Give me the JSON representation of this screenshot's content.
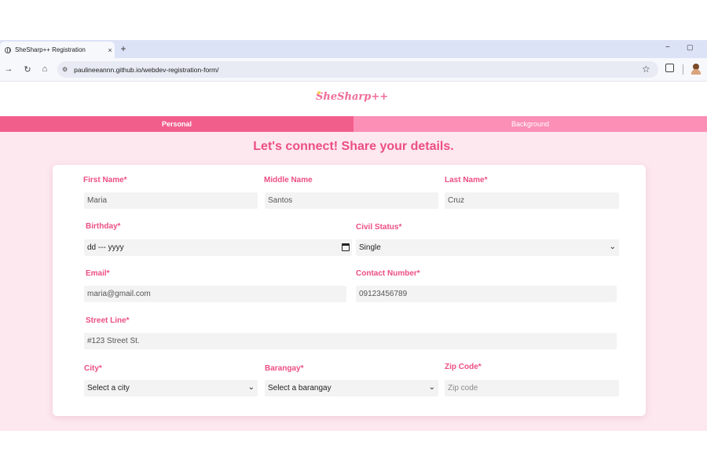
{
  "browser": {
    "tab_title": "SheSharp++ Registration",
    "tab_close": "×",
    "new_tab": "+",
    "url": "paulineeannn.github.io/webdev-registration-form/",
    "minimize": "−",
    "maximize": "▢"
  },
  "logo": {
    "text": "SheSharp++"
  },
  "steps": {
    "personal": "Personal",
    "background": "Background"
  },
  "heading": "Let's connect! Share your details.",
  "form": {
    "first_name": {
      "label": "First Name*",
      "value": "Maria"
    },
    "middle_name": {
      "label": "Middle Name",
      "value": "Santos"
    },
    "last_name": {
      "label": "Last Name*",
      "value": "Cruz"
    },
    "birthday": {
      "label": "Birthday*",
      "value": "dd --- yyyy"
    },
    "civil_status": {
      "label": "Civil Status*",
      "value": "Single"
    },
    "email": {
      "label": "Email*",
      "value": "maria@gmail.com"
    },
    "contact": {
      "label": "Contact Number*",
      "value": "09123456789"
    },
    "street": {
      "label": "Street Line*",
      "value": "#123 Street St."
    },
    "city": {
      "label": "City*",
      "value": "Select a city"
    },
    "barangay": {
      "label": "Barangay*",
      "value": "Select a barangay"
    },
    "zip": {
      "label": "Zip Code*",
      "placeholder": "Zip code"
    }
  },
  "colors": {
    "accent": "#ec4e82",
    "step_active": "#f25e8c",
    "step_inactive": "#fb8fb6",
    "page_bg": "#fde8ef"
  }
}
